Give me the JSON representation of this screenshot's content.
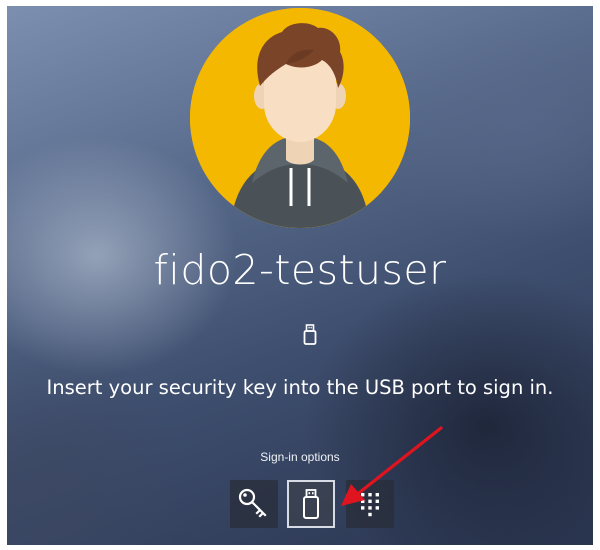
{
  "user": {
    "name": "fido2-testuser"
  },
  "prompt": {
    "message": "Insert your security key into the USB port to sign in."
  },
  "sign_in_options": {
    "label": "Sign-in options",
    "options": [
      {
        "icon": "key-icon",
        "selected": false
      },
      {
        "icon": "usb-security-key-icon",
        "selected": true
      },
      {
        "icon": "pin-keypad-icon",
        "selected": false
      }
    ]
  },
  "colors": {
    "avatar_background": "#f5b800",
    "annotation_arrow": "#e0141e",
    "text": "#ffffff"
  }
}
